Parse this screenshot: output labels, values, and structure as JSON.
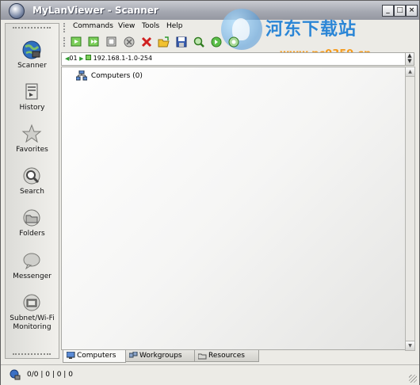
{
  "window": {
    "title": "MyLanViewer - Scanner",
    "controls": {
      "minimize": "_",
      "maximize": "□",
      "close": "×"
    }
  },
  "watermark": {
    "name": "河东下载站",
    "url": "www.pc0359.cn"
  },
  "sidebar": {
    "items": [
      {
        "label": "Scanner",
        "icon": "scanner-globe-icon"
      },
      {
        "label": "History",
        "icon": "history-icon"
      },
      {
        "label": "Favorites",
        "icon": "star-icon"
      },
      {
        "label": "Search",
        "icon": "search-icon"
      },
      {
        "label": "Folders",
        "icon": "folders-icon"
      },
      {
        "label": "Messenger",
        "icon": "messenger-icon"
      },
      {
        "label": "Subnet/Wi-Fi Monitoring",
        "icon": "monitoring-icon"
      }
    ]
  },
  "menu": {
    "items": [
      "Commands",
      "View",
      "Tools",
      "Help"
    ]
  },
  "toolbar": {
    "tools": [
      "scan-start-icon",
      "scan-next-icon",
      "scan-refresh-icon",
      "stop-icon",
      "delete-icon",
      "open-icon",
      "save-icon",
      "find-icon",
      "find-next-icon",
      "options-icon"
    ]
  },
  "address": {
    "prefix": "01",
    "range": "192.168.1-1.0-254"
  },
  "tree": {
    "root_label": "Computers (0)"
  },
  "tabs": [
    {
      "label": "Computers",
      "active": true
    },
    {
      "label": "Workgroups",
      "active": false
    },
    {
      "label": "Resources",
      "active": false
    }
  ],
  "status": {
    "text": "0/0 | 0 | 0 | 0"
  }
}
